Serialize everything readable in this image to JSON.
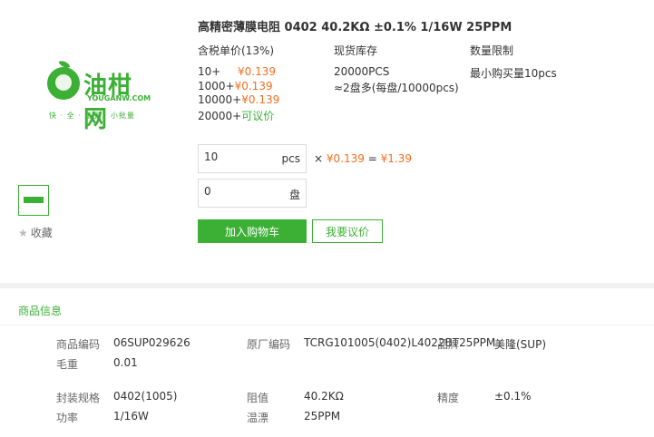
{
  "logo": {
    "brand": "油柑网",
    "domain": "YOUGANW.COM",
    "slogan": "快 · 全 · 正品 · 小批量"
  },
  "gallery": {
    "favorite_label": "收藏"
  },
  "product": {
    "title": "高精密薄膜电阻 0402 40.2KΩ ±0.1% 1/16W 25PPM"
  },
  "pricing": {
    "header": "含税单价(13%)",
    "tiers": [
      {
        "qty": "10+",
        "price": "¥0.139"
      },
      {
        "qty": "1000+",
        "price": "¥0.139"
      },
      {
        "qty": "10000+",
        "price": "¥0.139"
      },
      {
        "qty": "20000+",
        "price": "可议价"
      }
    ]
  },
  "stock": {
    "header": "现货库存",
    "quantity": "20000PCS",
    "reels": "≈2盘多(每盘/10000pcs)"
  },
  "limit": {
    "header": "数量限制",
    "value": "最小购买量10pcs"
  },
  "order": {
    "pcs_value": "10",
    "pcs_unit": "pcs",
    "reel_value": "0",
    "reel_unit": "盘",
    "times": "×",
    "unit_price": "¥0.139",
    "equals": "=",
    "total": "¥1.39"
  },
  "buttons": {
    "add_to_cart": "加入购物车",
    "request_quote": "我要议价"
  },
  "info": {
    "section_title": "商品信息",
    "fields": {
      "code_label": "商品编码",
      "code_value": "06SUP029626",
      "weight_label": "毛重",
      "weight_value": "0.01",
      "mfr_code_label": "原厂编码",
      "mfr_code_value": "TCRG101005(0402)L4022BT25PPM",
      "brand_label": "品牌",
      "brand_value": "美隆(SUP)",
      "package_label": "封装规格",
      "package_value": "0402(1005)",
      "resistance_label": "阻值",
      "resistance_value": "40.2KΩ",
      "accuracy_label": "精度",
      "accuracy_value": "±0.1%",
      "power_label": "功率",
      "power_value": "1/16W",
      "tempco_label": "温漂",
      "tempco_value": "25PPM"
    }
  },
  "colors": {
    "brand_green": "#3cb035",
    "price_orange": "#f46e1e"
  }
}
